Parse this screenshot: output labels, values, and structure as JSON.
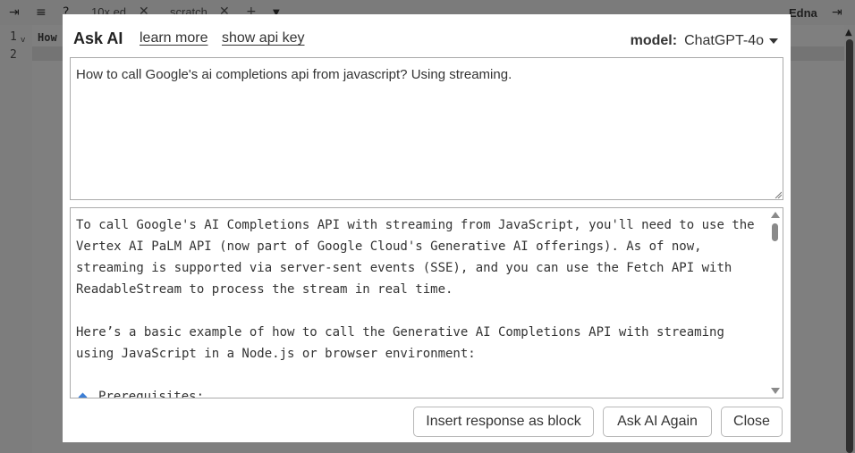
{
  "background": {
    "tabs": [
      {
        "label": "10x ed"
      },
      {
        "label": "scratch"
      }
    ],
    "app_name": "Edna",
    "line_numbers": [
      "1",
      "2"
    ],
    "editor_text": "How"
  },
  "dialog": {
    "title": "Ask AI",
    "links": {
      "learn_more": "learn more",
      "show_api_key": "show api key"
    },
    "model_label": "model:",
    "model_value": "ChatGPT-4o",
    "prompt": "How to call Google's ai completions api from javascript? Using streaming.",
    "response": {
      "paragraphs": [
        "To call Google's AI Completions API with streaming from JavaScript, you'll need to use the Vertex AI PaLM API (now part of Google Cloud's Generative AI offerings). As of now, streaming is supported via server-sent events (SSE), and you can use the Fetch API with ReadableStream to process the stream in real time.",
        "Here’s a basic example of how to call the Generative AI Completions API with streaming using JavaScript in a Node.js or browser environment:"
      ],
      "bullet": "Prerequisites:"
    },
    "buttons": {
      "insert": "Insert response as block",
      "ask_again": "Ask AI Again",
      "close": "Close"
    }
  },
  "colors": {
    "accent_bullet": "#3d7fd6",
    "overlay": "#7f7f7f"
  }
}
